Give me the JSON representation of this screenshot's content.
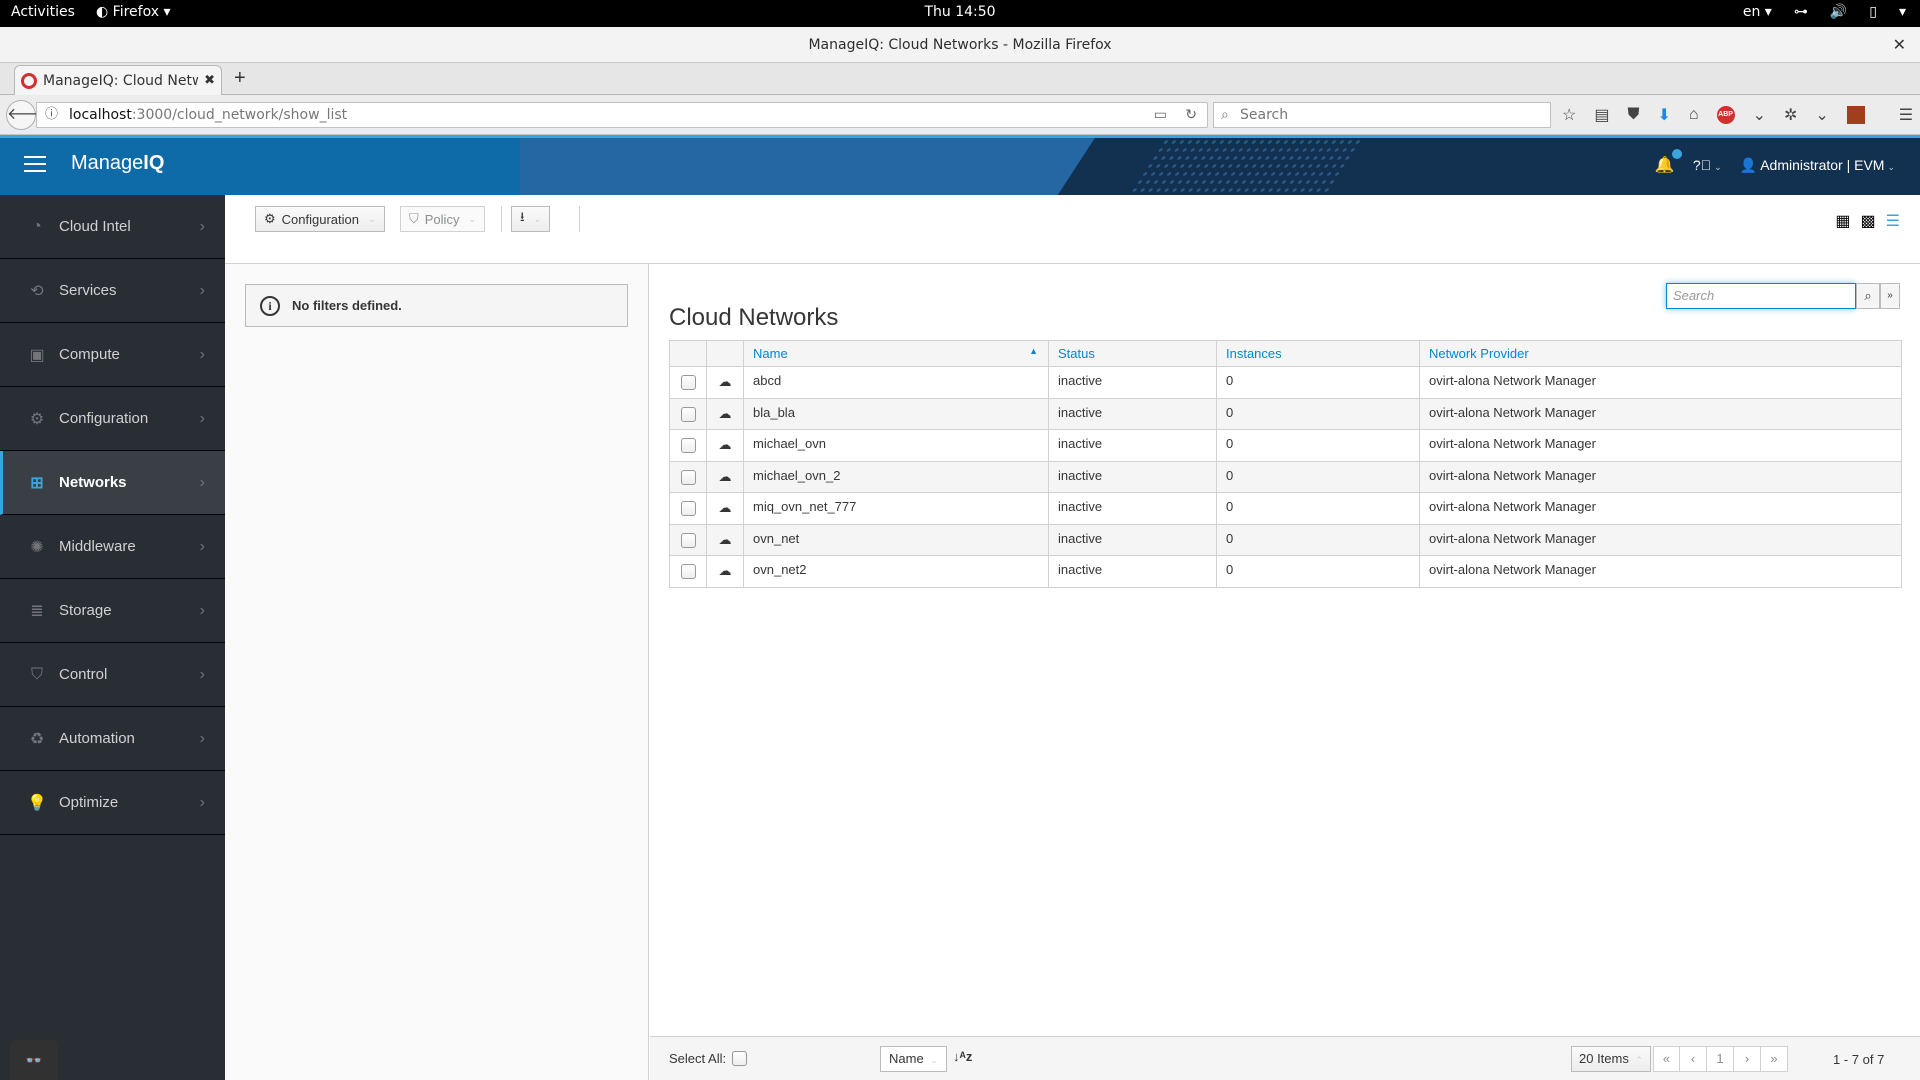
{
  "os": {
    "activities": "Activities",
    "app_menu": "Firefox",
    "clock": "Thu 14:50",
    "lang": "en"
  },
  "window": {
    "title": "ManageIQ: Cloud Networks - Mozilla Firefox",
    "close": "✕"
  },
  "browser": {
    "tab_title": "ManageIQ: Cloud Netw",
    "url_host": "localhost",
    "url_path": ":3000/cloud_network/show_list",
    "search_placeholder": "Search"
  },
  "app": {
    "brand_a": "Manage",
    "brand_b": "IQ",
    "user": "Administrator | EVM"
  },
  "sidebar": {
    "items": [
      {
        "label": "Cloud Intel",
        "icon": "◔"
      },
      {
        "label": "Services",
        "icon": "⟲"
      },
      {
        "label": "Compute",
        "icon": "▣"
      },
      {
        "label": "Configuration",
        "icon": "⚙"
      },
      {
        "label": "Networks",
        "icon": "⊞",
        "active": true
      },
      {
        "label": "Middleware",
        "icon": "✺"
      },
      {
        "label": "Storage",
        "icon": "≣"
      },
      {
        "label": "Control",
        "icon": "⛉"
      },
      {
        "label": "Automation",
        "icon": "♻"
      },
      {
        "label": "Optimize",
        "icon": "💡"
      }
    ]
  },
  "toolbar": {
    "configuration": "Configuration",
    "policy": "Policy"
  },
  "filters": {
    "message": "No filters defined."
  },
  "main": {
    "title": "Cloud Networks",
    "search_placeholder": "Search",
    "columns": [
      "Name",
      "Status",
      "Instances",
      "Network Provider"
    ],
    "rows": [
      {
        "name": "abcd",
        "status": "inactive",
        "instances": "0",
        "provider": "ovirt-alona Network Manager"
      },
      {
        "name": "bla_bla",
        "status": "inactive",
        "instances": "0",
        "provider": "ovirt-alona Network Manager"
      },
      {
        "name": "michael_ovn",
        "status": "inactive",
        "instances": "0",
        "provider": "ovirt-alona Network Manager"
      },
      {
        "name": "michael_ovn_2",
        "status": "inactive",
        "instances": "0",
        "provider": "ovirt-alona Network Manager"
      },
      {
        "name": "miq_ovn_net_777",
        "status": "inactive",
        "instances": "0",
        "provider": "ovirt-alona Network Manager"
      },
      {
        "name": "ovn_net",
        "status": "inactive",
        "instances": "0",
        "provider": "ovirt-alona Network Manager"
      },
      {
        "name": "ovn_net2",
        "status": "inactive",
        "instances": "0",
        "provider": "ovirt-alona Network Manager"
      }
    ]
  },
  "footer": {
    "select_all": "Select All:",
    "sort_by": "Name",
    "per_page": "20 Items",
    "page": "1",
    "count": "1 - 7 of 7"
  },
  "colors": {
    "accent": "#0088ce",
    "header_blue": "#0f6aa8",
    "sidebar_bg": "#292e34",
    "active_bar": "#39a5dc"
  }
}
